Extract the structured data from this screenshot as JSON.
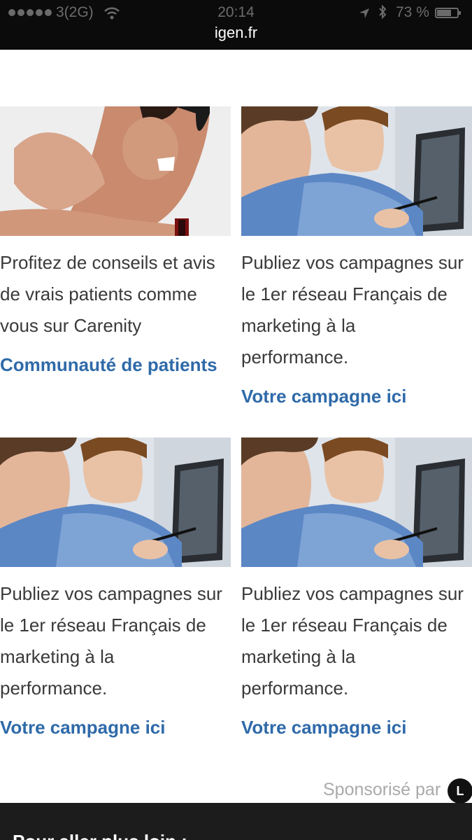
{
  "status_bar": {
    "carrier": "3(2G)",
    "time": "20:14",
    "battery": "73 %",
    "battery_level": 0.73
  },
  "browser": {
    "url": "igen.fr"
  },
  "ads": [
    {
      "image": "woman-scratching-face",
      "text": "Profitez de conseils et avis\nde vrais patients comme\nvous sur Carenity",
      "link": "Communauté de patients"
    },
    {
      "image": "people-at-computer",
      "text": "Publiez vos campagnes sur\nle 1er réseau Français de\nmarketing à la\nperformance.",
      "link": "Votre campagne ici"
    },
    {
      "image": "people-at-computer",
      "text": "Publiez vos campagnes sur\nle 1er réseau Français de\nmarketing à la\nperformance.",
      "link": "Votre campagne ici"
    },
    {
      "image": "people-at-computer",
      "text": "Publiez vos campagnes sur\nle 1er réseau Français de\nmarketing à la\nperformance.",
      "link": "Votre campagne ici"
    }
  ],
  "sponsor": {
    "label": "Sponsorisé par",
    "logo_letter": "L"
  },
  "footer": {
    "title": "Pour aller plus loin :"
  },
  "colors": {
    "link": "#2f6aa9",
    "text": "#3a3a3a",
    "status_bg": "#0b0b0b"
  }
}
